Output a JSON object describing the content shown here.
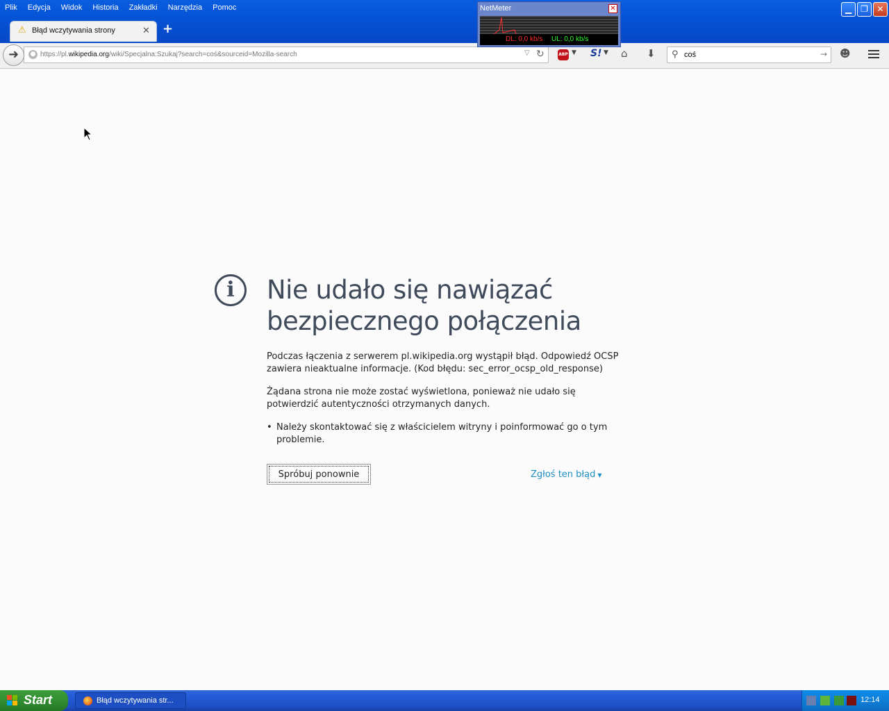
{
  "menu": {
    "items": [
      {
        "label": "Plik"
      },
      {
        "label": "Edycja"
      },
      {
        "label": "Widok"
      },
      {
        "label": "Historia"
      },
      {
        "label": "Zakładki"
      },
      {
        "label": "Narzędzia"
      },
      {
        "label": "Pomoc"
      }
    ]
  },
  "tab": {
    "title": "Błąd wczytywania strony",
    "close_glyph": "✕",
    "new_tab_glyph": "+"
  },
  "netmeter": {
    "title": "NetMeter",
    "dl": "DL: 0,0 kb/s",
    "ul": "UL: 0,0 kb/s"
  },
  "urlbar": {
    "prefix": "https://pl.",
    "host": "wikipedia.org",
    "path": "/wiki/Specjalna:Szukaj?search=coś&sourceid=Mozilla-search"
  },
  "search": {
    "value": "coś"
  },
  "error": {
    "title": "Nie udało się nawiązać bezpiecznego połączenia",
    "paragraph1": "Podczas łączenia z serwerem pl.wikipedia.org wystąpił błąd. Odpowiedź OCSP zawiera nieaktualne informacje. (Kod błędu: sec_error_ocsp_old_response)",
    "paragraph2": "Żądana strona nie może zostać wyświetlona, ponieważ nie udało się potwierdzić autentyczności otrzymanych danych.",
    "bullet": "Należy skontaktować się z właścicielem witryny i poinformować go o tym problemie.",
    "retry_label": "Spróbuj ponownie",
    "report_label": "Zgłoś ten błąd"
  },
  "taskbar": {
    "start_label": "Start",
    "task_label": "Błąd wczytywania str...",
    "clock": "12:14"
  },
  "colors": {
    "accent_link": "#1e8fc4",
    "title_text": "#3f4a5a",
    "xp_blue": "#0653d6",
    "start_green": "#2f8a2f"
  }
}
